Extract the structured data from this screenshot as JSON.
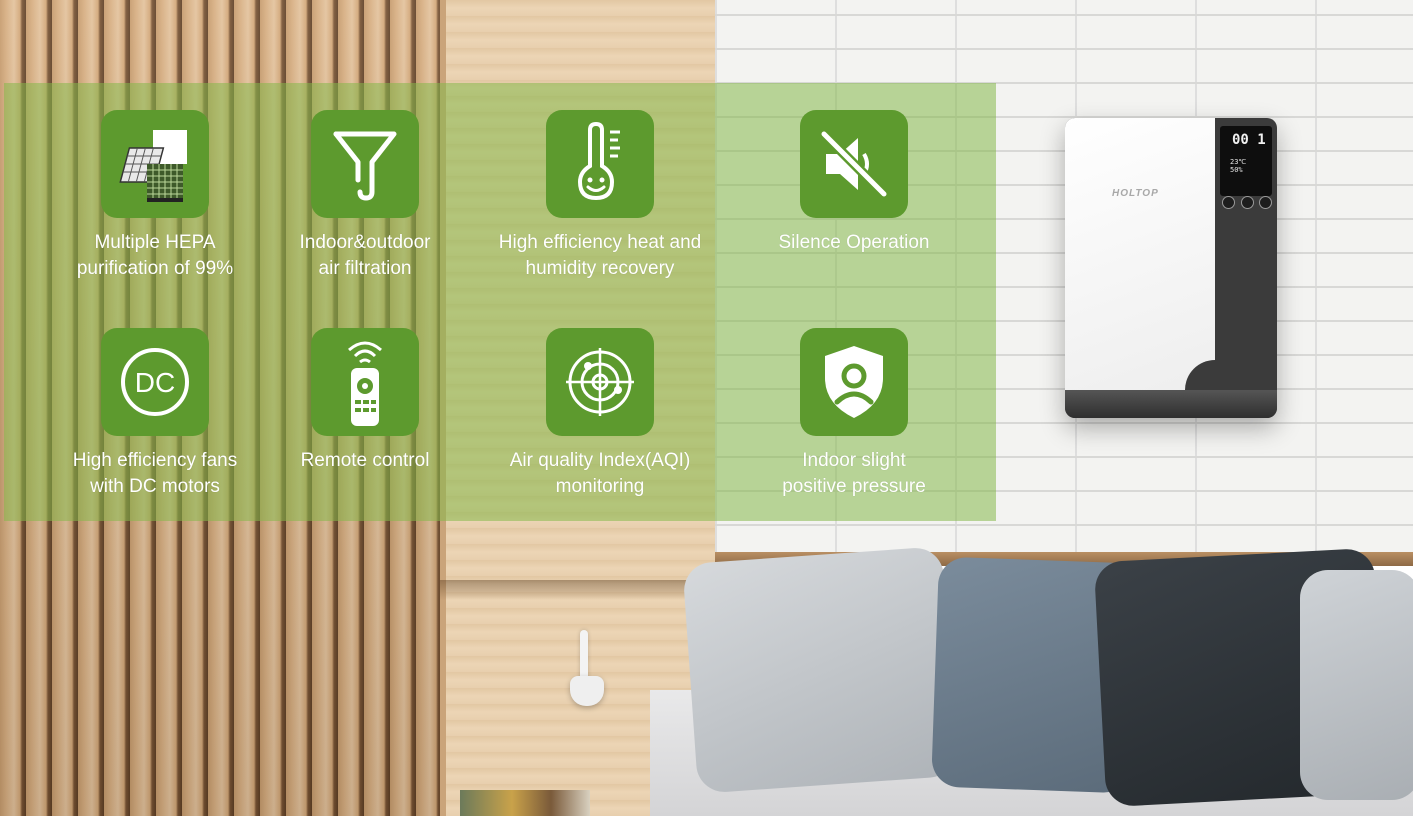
{
  "device": {
    "brand": "HOLTOP",
    "display_main": "00 1",
    "display_temp": "23℃",
    "display_humidity": "50%"
  },
  "features": [
    {
      "label": "Multiple HEPA\npurification of 99%",
      "icon": "hepa-filter-icon"
    },
    {
      "label": "Indoor&outdoor\nair filtration",
      "icon": "funnel-icon"
    },
    {
      "label": "High efficiency heat and\nhumidity recovery",
      "icon": "thermometer-smile-icon"
    },
    {
      "label": "Silence Operation",
      "icon": "speaker-mute-icon"
    },
    {
      "label": "High efficiency fans\nwith DC motors",
      "icon": "dc-motor-icon"
    },
    {
      "label": "Remote control",
      "icon": "remote-control-icon"
    },
    {
      "label": "Air quality Index(AQI)\nmonitoring",
      "icon": "radar-icon"
    },
    {
      "label": "Indoor slight\npositive pressure",
      "icon": "shield-user-icon"
    }
  ],
  "colors": {
    "overlay": "#85b84a",
    "icon_tile": "#5d9a2e",
    "label_text": "#ffffff"
  }
}
